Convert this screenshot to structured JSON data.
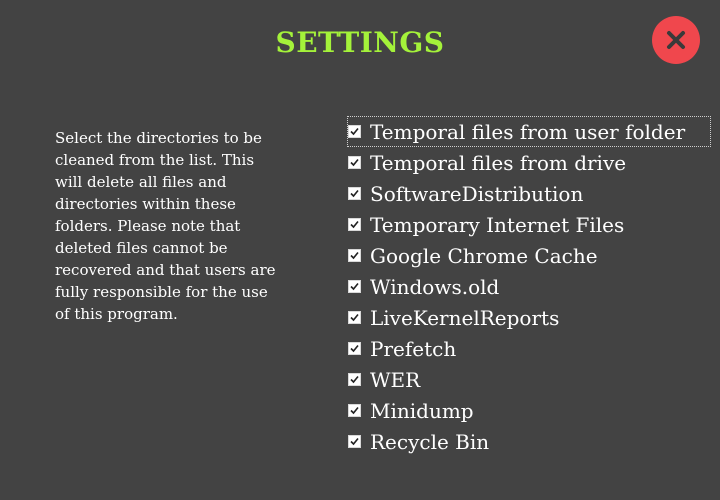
{
  "window": {
    "title": "SETTINGS"
  },
  "icons": {
    "close": "close-icon",
    "checkmark": "checkmark-icon"
  },
  "colors": {
    "background": "#434343",
    "title": "#a4f23a",
    "close_button": "#f0474d",
    "text": "#ffffff"
  },
  "description": "Select the directories to be cleaned from the list. This will delete all files and directories within these folders. Please note that deleted files cannot be recovered and that users are fully responsible for the use of this program.",
  "directories": [
    {
      "label": "Temporal files from user folder",
      "checked": true
    },
    {
      "label": "Temporal files from drive",
      "checked": true
    },
    {
      "label": "SoftwareDistribution",
      "checked": true
    },
    {
      "label": "Temporary Internet Files",
      "checked": true
    },
    {
      "label": "Google Chrome Cache",
      "checked": true
    },
    {
      "label": "Windows.old",
      "checked": true
    },
    {
      "label": "LiveKernelReports",
      "checked": true
    },
    {
      "label": "Prefetch",
      "checked": true
    },
    {
      "label": "WER",
      "checked": true
    },
    {
      "label": "Minidump",
      "checked": true
    },
    {
      "label": "Recycle Bin",
      "checked": true
    }
  ]
}
